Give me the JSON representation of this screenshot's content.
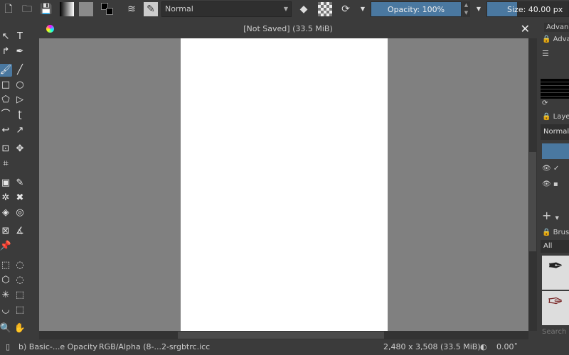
{
  "toolbar": {
    "icons": [
      "new-document-icon",
      "open-folder-icon",
      "save-icon",
      "gradient-icon",
      "pattern-icon",
      "color-swap-icon",
      "brush-settings-icon",
      "brush-preset-icon"
    ],
    "blend_mode": "Normal",
    "eraser": "eraser-icon",
    "alpha_lock": "alpha-lock-icon",
    "reload": "reload-icon",
    "opacity": "Opacity: 100%",
    "opacity_value": 100,
    "size": "Size: 40.00 px",
    "accent": "#4a78a0"
  },
  "toolbox": {
    "tools": [
      [
        "select-shapes-icon",
        "↖"
      ],
      [
        "text-icon",
        "T"
      ],
      [
        "edit-shapes-icon",
        "↱"
      ],
      [
        "calligraphy-icon",
        "✒"
      ],
      [
        "freehand-brush-icon",
        "🖌"
      ],
      [
        "line-icon",
        "╱"
      ],
      [
        "rectangle-icon",
        "□"
      ],
      [
        "ellipse-icon",
        "○"
      ],
      [
        "polygon-icon",
        "⬠"
      ],
      [
        "polyline-icon",
        "▷"
      ],
      [
        "bezier-icon",
        "⌒"
      ],
      [
        "freehand-path-icon",
        "ʈ"
      ],
      [
        "dynamic-brush-icon",
        "↩"
      ],
      [
        "multibrush-icon",
        "↗"
      ],
      [
        "transform-icon",
        "⊡"
      ],
      [
        "move-icon",
        "✥"
      ],
      [
        "crop-icon",
        "⌗"
      ],
      null,
      [
        "gradient-tool-icon",
        "▣"
      ],
      [
        "color-picker-icon",
        "✎"
      ],
      [
        "smart-patch-icon",
        "✲"
      ],
      [
        "assistant-icon",
        "✖"
      ],
      [
        "fill-icon",
        "◈"
      ],
      [
        "enclosed-fill-icon",
        "◎"
      ],
      [
        "perspective-grid-icon",
        "⊠"
      ],
      [
        "measure-icon",
        "∡"
      ],
      [
        "reference-icon",
        "📌"
      ],
      null,
      [
        "rect-select-icon",
        "⬚"
      ],
      [
        "ellipse-select-icon",
        "◌"
      ],
      [
        "polygon-select-icon",
        "⬡"
      ],
      [
        "freehand-select-icon",
        "◌"
      ],
      [
        "contiguous-select-icon",
        "✳"
      ],
      [
        "similar-select-icon",
        "⬚"
      ],
      [
        "bezier-select-icon",
        "◡"
      ],
      [
        "magnetic-select-icon",
        "⬚"
      ],
      [
        "zoom-icon",
        "🔍"
      ],
      [
        "pan-icon",
        "✋"
      ]
    ]
  },
  "document": {
    "title": "[Not Saved]  (33.5 MiB)"
  },
  "dock": {
    "advanced_tab": "Advanced Color Selector",
    "advanced_title": "Advanced Color Selector",
    "layers_title": "Layers",
    "layer_blend": "Normal",
    "brushes_title": "Brush Presets",
    "brush_filter": "All",
    "search_placeholder": "Search"
  },
  "status": {
    "brush": "b) Basic-...e Opacity",
    "color_space": "RGB/Alpha (8-...2-srgbtrc.icc",
    "image_size": "2,480 x 3,508 (33.5 MiB)",
    "rotation": "0.00˚"
  }
}
